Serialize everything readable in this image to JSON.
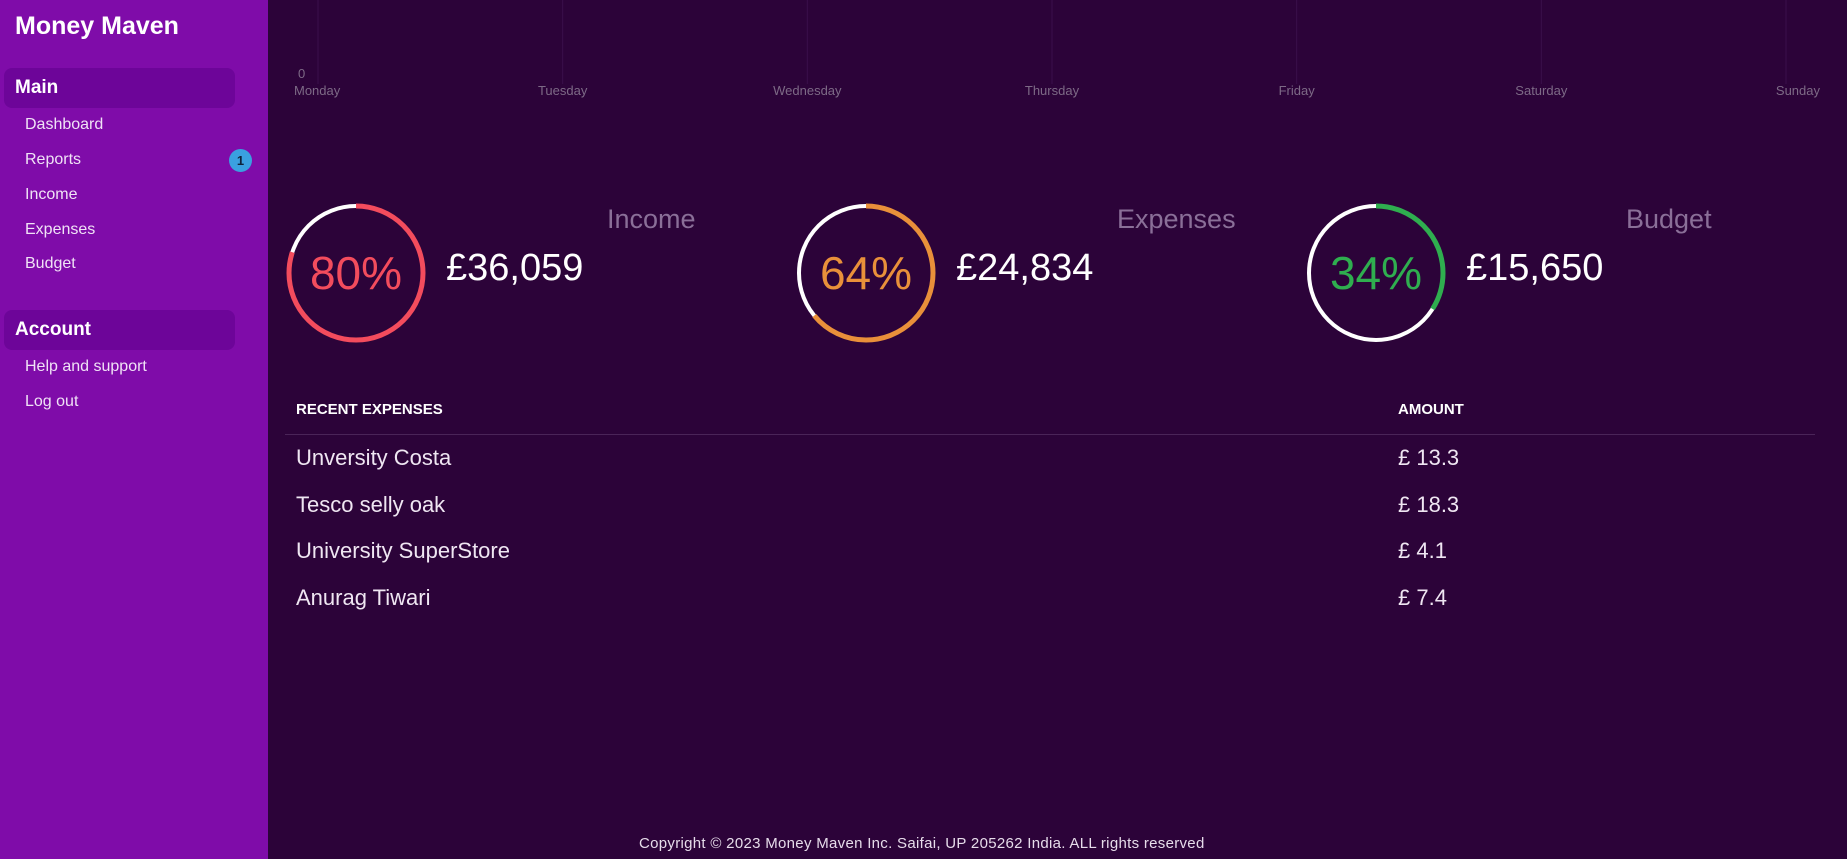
{
  "app": {
    "title": "Money Maven"
  },
  "sidebar": {
    "main_heading": "Main",
    "main_items": [
      {
        "label": "Dashboard"
      },
      {
        "label": "Reports",
        "badge": "1"
      },
      {
        "label": "Income"
      },
      {
        "label": "Expenses"
      },
      {
        "label": "Budget"
      }
    ],
    "account_heading": "Account",
    "account_items": [
      {
        "label": "Help and support"
      },
      {
        "label": "Log out"
      }
    ]
  },
  "weekly_chart": {
    "type": "bar",
    "categories": [
      "Monday",
      "Tuesday",
      "Wednesday",
      "Thursday",
      "Friday",
      "Saturday",
      "Sunday"
    ],
    "y_tick": "0",
    "grid": true
  },
  "kpis": [
    {
      "label": "Income",
      "percent_text": "80%",
      "percent": 80,
      "amount": "£36,059",
      "color": "#f34c5d"
    },
    {
      "label": "Expenses",
      "percent_text": "64%",
      "percent": 64,
      "amount": "£24,834",
      "color": "#e9903a"
    },
    {
      "label": "Budget",
      "percent_text": "34%",
      "percent": 34,
      "amount": "£15,650",
      "color": "#2fae4f"
    }
  ],
  "recent_expenses": {
    "headers": {
      "name": "Recent Expenses",
      "amount": "Amount"
    },
    "rows": [
      {
        "name": "Unversity Costa",
        "amount": "£ 13.3"
      },
      {
        "name": "Tesco selly oak",
        "amount": "£ 18.3"
      },
      {
        "name": "University SuperStore",
        "amount": "£ 4.1"
      },
      {
        "name": "Anurag Tiwari",
        "amount": "£ 7.4"
      }
    ]
  },
  "footer": {
    "text": "Copyright © 2023 Money Maven Inc. Saifai, UP 205262 India. ALL rights reserved"
  }
}
